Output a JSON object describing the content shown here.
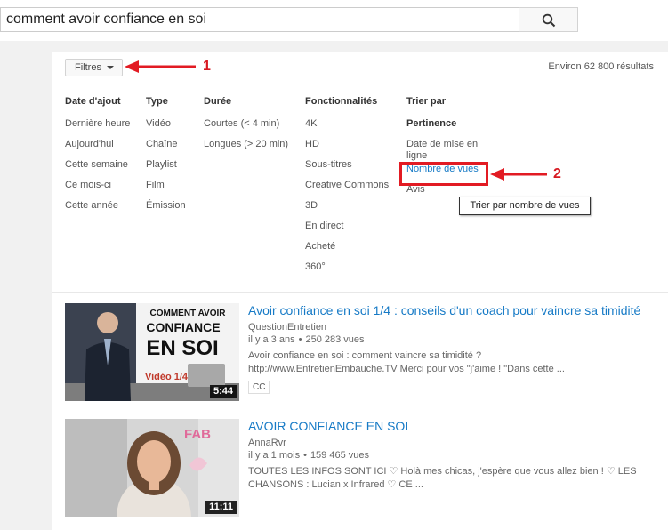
{
  "search": {
    "query": "comment avoir confiance en soi",
    "button_icon": "search-icon"
  },
  "filters": {
    "button_label": "Filtres",
    "results_count": "Environ 62 800 résultats",
    "columns": [
      {
        "heading": "Date d'ajout",
        "items": [
          "Dernière heure",
          "Aujourd'hui",
          "Cette semaine",
          "Ce mois-ci",
          "Cette année"
        ]
      },
      {
        "heading": "Type",
        "items": [
          "Vidéo",
          "Chaîne",
          "Playlist",
          "Film",
          "Émission"
        ]
      },
      {
        "heading": "Durée",
        "items": [
          "Courtes (< 4 min)",
          "Longues (> 20 min)"
        ]
      },
      {
        "heading": "Fonctionnalités",
        "items": [
          "4K",
          "HD",
          "Sous-titres",
          "Creative Commons",
          "3D",
          "En direct",
          "Acheté",
          "360°"
        ]
      },
      {
        "heading": "Trier par",
        "items": [
          "Pertinence",
          "Date de mise en ligne",
          "Nombre de vues",
          "Avis"
        ]
      }
    ],
    "tooltip": "Trier par nombre de vues"
  },
  "annotations": {
    "label_1": "1",
    "label_2": "2",
    "color": "#e21b23"
  },
  "videos": [
    {
      "title": "Avoir confiance en soi 1/4 : conseils d'un coach pour vaincre sa timidité",
      "channel": "QuestionEntretien",
      "age": "il y a 3 ans",
      "views": "250 283 vues",
      "description_1": "Avoir confiance en soi : comment vaincre sa timidité ?",
      "description_2": "http://www.EntretienEmbauche.TV Merci pour vos \"j'aime ! \"Dans cette ...",
      "duration": "5:44",
      "badge": "CC",
      "thumb_line_1": "COMMENT AVOIR",
      "thumb_line_2": "CONFIANCE",
      "thumb_line_3": "EN SOI",
      "thumb_line_4": "Vidéo 1/4"
    },
    {
      "title": "AVOIR CONFIANCE EN SOI",
      "channel": "AnnaRvr",
      "age": "il y a 1 mois",
      "views": "159 465 vues",
      "description_1": "TOUTES LES INFOS SONT ICI ♡ Holà mes chicas, j'espère que vous allez bien ! ♡ LES",
      "description_2": "CHANSONS : Lucian x Infrared ♡ CE ...",
      "duration": "11:11",
      "thumb_text": "FAB"
    }
  ],
  "colors": {
    "link": "#167ac6",
    "page_bg": "#f1f1f1"
  }
}
